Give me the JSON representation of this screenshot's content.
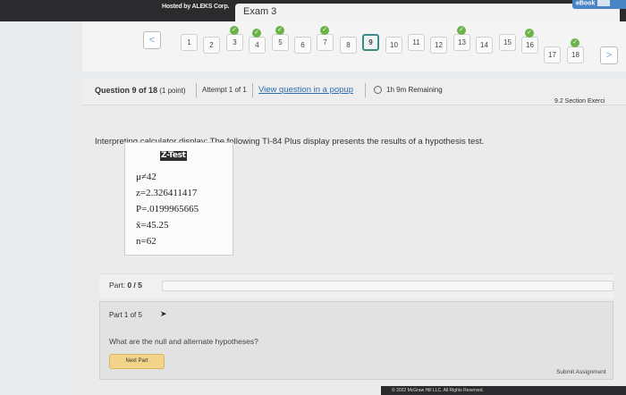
{
  "header": {
    "hosted_by": "Hosted by ALEKS Corp.",
    "exam_title": "Exam 3",
    "ebook_label": "eBook"
  },
  "nav": {
    "prev_symbol": "<",
    "next_symbol": ">",
    "questions": [
      {
        "label": "1",
        "completed": false
      },
      {
        "label": "2",
        "completed": false
      },
      {
        "label": "3",
        "completed": true
      },
      {
        "label": "4",
        "completed": true
      },
      {
        "label": "5",
        "completed": true
      },
      {
        "label": "6",
        "completed": false
      },
      {
        "label": "7",
        "completed": true
      },
      {
        "label": "8",
        "completed": false
      },
      {
        "label": "9",
        "completed": false,
        "current": true
      },
      {
        "label": "10",
        "completed": false
      },
      {
        "label": "11",
        "completed": false
      },
      {
        "label": "12",
        "completed": false
      },
      {
        "label": "13",
        "completed": true
      },
      {
        "label": "14",
        "completed": false
      },
      {
        "label": "15",
        "completed": false
      },
      {
        "label": "16",
        "completed": true
      },
      {
        "label": "17",
        "completed": false
      },
      {
        "label": "18",
        "completed": true
      }
    ]
  },
  "question_header": {
    "question_label": "Question 9 of 18",
    "points": "(1 point)",
    "attempt": "Attempt 1 of 1",
    "view_popup": "View question in a popup",
    "time_remaining": "1h 9m Remaining",
    "section": "9.2 Section Exerci"
  },
  "content": {
    "prompt": "Interpreting calculator display: The following TI-84 Plus display presents the results of a hypothesis test.",
    "calculator": {
      "title": "Z-Test",
      "lines": [
        "μ≠42",
        "z=2.326411417",
        "P=.0199965665",
        "x̄=45.25",
        "n=62"
      ]
    },
    "part_label_prefix": "Part:",
    "part_score": "0 / 5",
    "progress": 0.0,
    "part1_label": "Part 1 of 5",
    "question_text": "What are the null and alternate hypotheses?",
    "next_button": "Next Part",
    "submit_button": "Submit Assignment"
  },
  "footer": {
    "copyright": "© 2022 McGraw Hill LLC. All Rights Reserved."
  },
  "colors": {
    "check_green": "#6bb24a",
    "link_blue": "#2a6cb0",
    "current_border": "#3f8a85",
    "next_button": "#f2d48b"
  }
}
